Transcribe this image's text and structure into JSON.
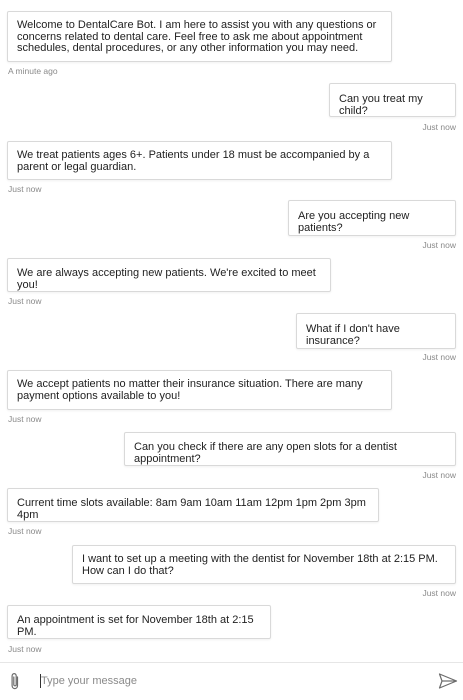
{
  "conversation": [
    {
      "from": "bot",
      "text": "Welcome to DentalCare Bot. I am here to assist you with any questions or concerns related to dental care. Feel free to ask me about appointment schedules, dental procedures, or any other information you may need.",
      "time": "A minute ago"
    },
    {
      "from": "user",
      "text": "Can you treat my child?",
      "time": "Just now"
    },
    {
      "from": "bot",
      "text": "We treat patients ages 6+. Patients under 18 must be accompanied by a parent or legal guardian.",
      "time": "Just now"
    },
    {
      "from": "user",
      "text": "Are you accepting new patients?",
      "time": "Just now"
    },
    {
      "from": "bot",
      "text": "We are always accepting new patients. We're excited to meet you!",
      "time": "Just now"
    },
    {
      "from": "user",
      "text": "What if I don't have insurance?",
      "time": "Just now"
    },
    {
      "from": "bot",
      "text": "We accept patients no matter their insurance situation. There are many payment options available to you!",
      "time": "Just now"
    },
    {
      "from": "user",
      "text": "Can you check if there are any open slots for a dentist appointment?",
      "time": "Just now"
    },
    {
      "from": "bot",
      "text": "Current time slots available: 8am 9am 10am 11am 12pm 1pm 2pm 3pm 4pm",
      "time": "Just now"
    },
    {
      "from": "user",
      "text": "I want to set up a meeting with the dentist for November 18th at 2:15 PM. How can I do that?",
      "time": "Just now"
    },
    {
      "from": "bot",
      "text": "An appointment is set for November 18th at 2:15 PM.",
      "time": "Just now"
    }
  ],
  "composer": {
    "placeholder": "Type your message",
    "attach_icon": "paperclip-icon",
    "send_icon": "send-icon"
  },
  "colors": {
    "bubble_border": "#d9d9d9",
    "timestamp": "#8a8a8a",
    "text": "#1f1f1f"
  }
}
